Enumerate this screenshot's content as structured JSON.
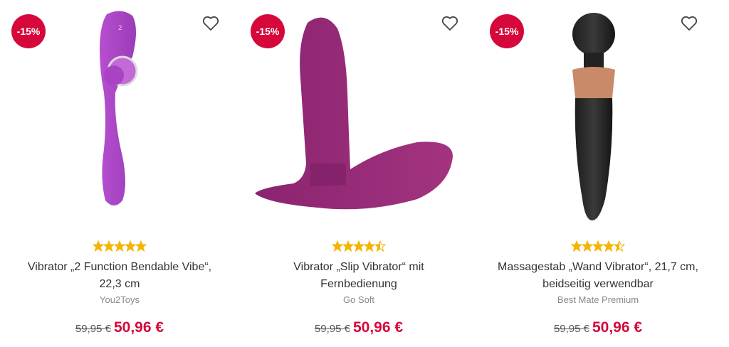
{
  "colors": {
    "sale": "#d6083b",
    "star": "#f4b400"
  },
  "products": [
    {
      "badge": "-15%",
      "rating": 5,
      "title_line1": "Vibrator „2 Function Bendable Vibe“,",
      "title_line2": "22,3 cm",
      "brand": "You2Toys",
      "old_price": "59,95 €",
      "price": "50,96 €"
    },
    {
      "badge": "-15%",
      "rating": 4.5,
      "title_line1": "Vibrator „Slip Vibrator“ mit",
      "title_line2": "Fernbedienung",
      "brand": "Go Soft",
      "old_price": "59,95 €",
      "price": "50,96 €"
    },
    {
      "badge": "-15%",
      "rating": 4.5,
      "title_line1": "Massagestab „Wand Vibrator“, 21,7 cm,",
      "title_line2": "beidseitig verwendbar",
      "brand": "Best Mate Premium",
      "old_price": "59,95 €",
      "price": "50,96 €"
    }
  ]
}
